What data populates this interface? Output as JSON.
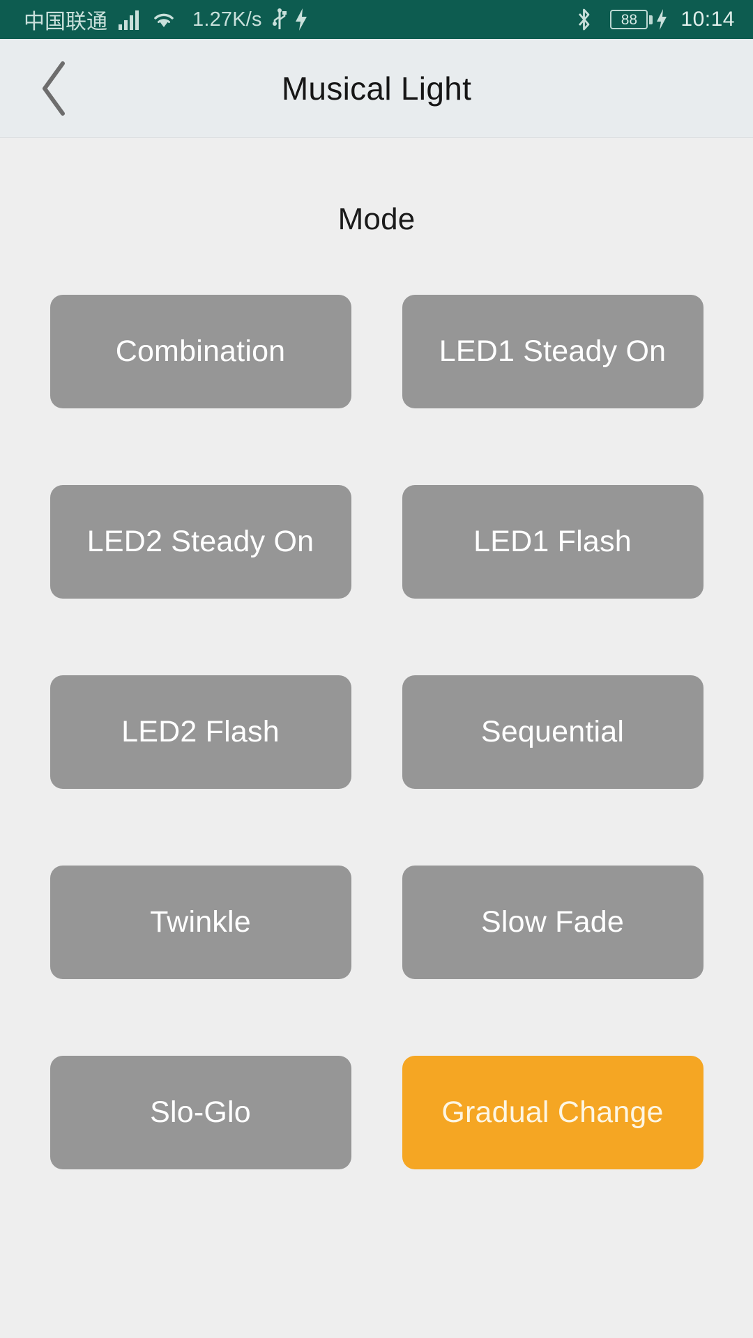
{
  "status_bar": {
    "carrier": "中国联通",
    "network_speed": "1.27K/s",
    "battery_level": "88",
    "time": "10:14",
    "icons": [
      "signal-bars-icon",
      "wifi-icon",
      "usb-icon",
      "charging-bolt-icon",
      "bluetooth-icon",
      "battery-icon",
      "charging-bolt-icon"
    ],
    "background_color": "#0d5c50"
  },
  "header": {
    "title": "Musical Light",
    "back_label": "back-chevron"
  },
  "main": {
    "section_title": "Mode",
    "selected_color": "#f5a623",
    "default_color": "#969696",
    "modes": [
      {
        "label": "Combination",
        "selected": false
      },
      {
        "label": "LED1 Steady On",
        "selected": false
      },
      {
        "label": "LED2 Steady On",
        "selected": false
      },
      {
        "label": "LED1 Flash",
        "selected": false
      },
      {
        "label": "LED2 Flash",
        "selected": false
      },
      {
        "label": "Sequential",
        "selected": false
      },
      {
        "label": "Twinkle",
        "selected": false
      },
      {
        "label": "Slow Fade",
        "selected": false
      },
      {
        "label": "Slo-Glo",
        "selected": false
      },
      {
        "label": "Gradual Change",
        "selected": true
      }
    ]
  }
}
